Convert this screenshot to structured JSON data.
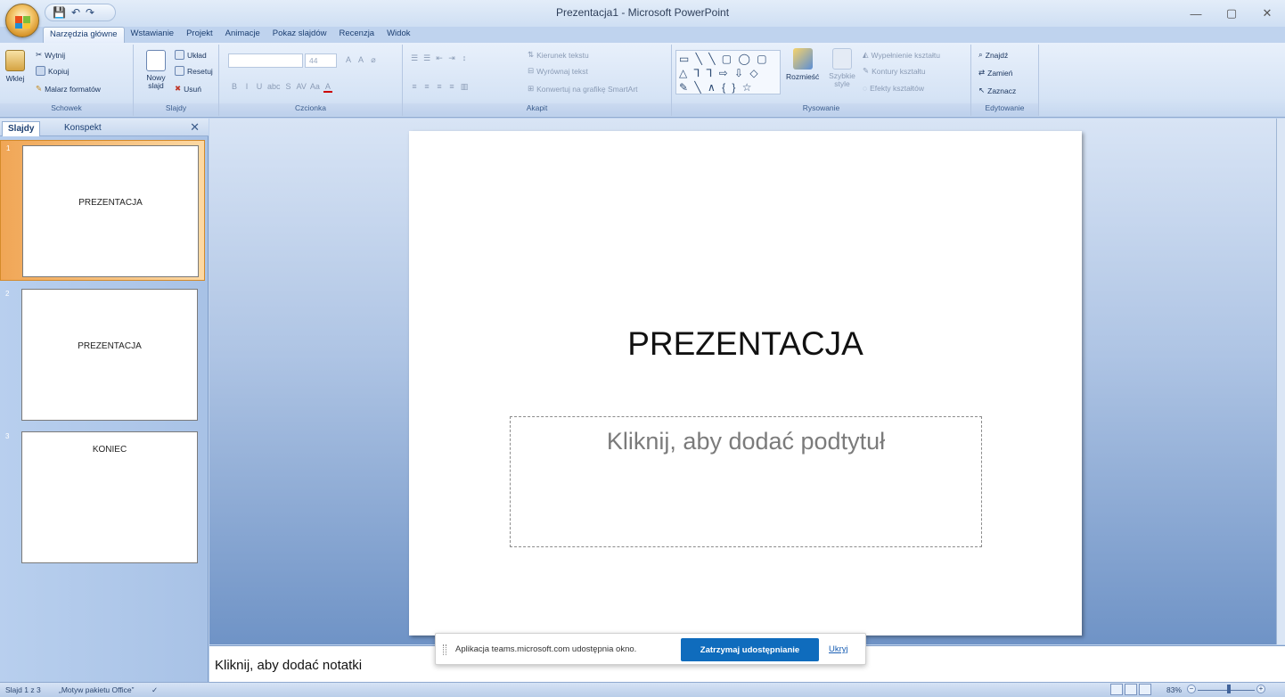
{
  "window": {
    "title": "Prezentacja1 - Microsoft PowerPoint",
    "controls": [
      "—",
      "▢",
      "✕"
    ]
  },
  "qat": {
    "save": "💾",
    "undo": "↶",
    "redo": "↷"
  },
  "tabs": [
    "Narzędzia główne",
    "Wstawianie",
    "Projekt",
    "Animacje",
    "Pokaz slajdów",
    "Recenzja",
    "Widok"
  ],
  "ribbon": {
    "clipboard": {
      "label": "Schowek",
      "paste": "Wklej",
      "cut": "Wytnij",
      "copy": "Kopiuj",
      "painter": "Malarz formatów"
    },
    "slides": {
      "label": "Slajdy",
      "new_slide": "Nowy slajd",
      "layout": "Układ",
      "reset": "Resetuj",
      "delete": "Usuń"
    },
    "font": {
      "label": "Czcionka",
      "size": "44",
      "buttons": [
        "B",
        "I",
        "U",
        "abc",
        "S",
        "AV",
        "Aa",
        "A"
      ]
    },
    "paragraph": {
      "label": "Akapit",
      "text_direction": "Kierunek tekstu",
      "align_text": "Wyrównaj tekst",
      "smartart": "Konwertuj na grafikę SmartArt"
    },
    "drawing": {
      "label": "Rysowanie",
      "shapes_row1": "▭ ╲ ╲ ▢ ◯ ▢",
      "shapes_row2": "△ ⅂ ⅂ ⇨ ⇩ ◇",
      "shapes_row3": "✎ ╲ ∧ { } ☆",
      "arrange": "Rozmieść",
      "quick_styles": "Szybkie style",
      "fill": "Wypełnienie kształtu",
      "outline": "Kontury kształtu",
      "effects": "Efekty kształtów"
    },
    "editing": {
      "label": "Edytowanie",
      "find": "Znajdź",
      "replace": "Zamień",
      "select": "Zaznacz"
    }
  },
  "left_pane": {
    "tabs": [
      "Slajdy",
      "Konspekt"
    ],
    "close": "✕",
    "slides": [
      {
        "num": "1",
        "title": "PREZENTACJA"
      },
      {
        "num": "2",
        "title": "PREZENTACJA"
      },
      {
        "num": "3",
        "title": "KONIEC"
      }
    ]
  },
  "slide": {
    "title": "PREZENTACJA",
    "subtitle_placeholder": "Kliknij, aby dodać podtytuł"
  },
  "notes": {
    "placeholder": "Kliknij, aby dodać notatki"
  },
  "share_banner": {
    "message": "Aplikacja teams.microsoft.com udostępnia okno.",
    "stop": "Zatrzymaj udostępnianie",
    "hide": "Ukryj"
  },
  "status": {
    "slide_info": "Slajd 1 z 3",
    "theme": "„Motyw pakietu Office”",
    "zoom": "83%"
  },
  "colors": {
    "selected_slide": "#f0a656",
    "share_button": "#0f6cbd"
  }
}
